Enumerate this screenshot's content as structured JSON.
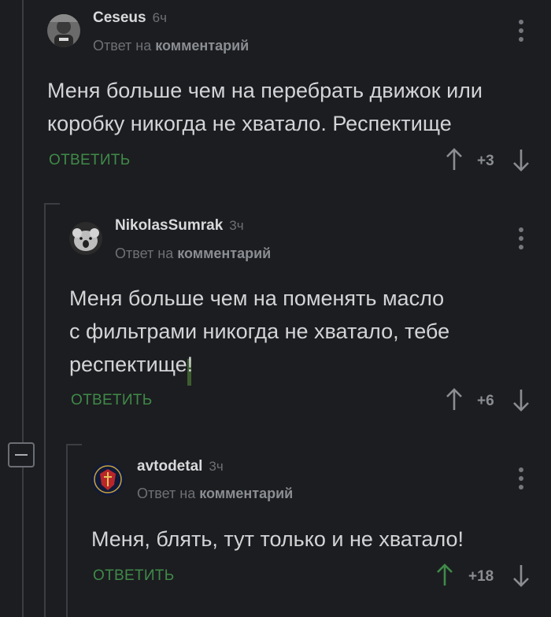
{
  "colors": {
    "background": "#1c1d20",
    "accent_green": "#3f8a49",
    "text": "#d3d4d6",
    "muted": "#6d7075"
  },
  "comments": [
    {
      "author": "Ceseus",
      "time": "6ч",
      "reply_prefix": "Ответ на",
      "reply_link": "комментарий",
      "text": "Меня больше чем на перебрать движок или\nкоробку никогда не хватало. Респектище",
      "reply_label": "ОТВЕТИТЬ",
      "score": "+3",
      "upvoted": false
    },
    {
      "author": "NikolasSumrak",
      "time": "3ч",
      "reply_prefix": "Ответ на",
      "reply_link": "комментарий",
      "text": "Меня больше чем на поменять масло\nс фильтрами никогда не хватало, тебе\nреспектище",
      "text_tail": "!",
      "reply_label": "ОТВЕТИТЬ",
      "score": "+6",
      "upvoted": false
    },
    {
      "author": "avtodetal",
      "time": "3ч",
      "reply_prefix": "Ответ на",
      "reply_link": "комментарий",
      "text": "Меня, блять, тут только и не хватало!",
      "reply_label": "ОТВЕТИТЬ",
      "score": "+18",
      "upvoted": true
    }
  ],
  "icons": {
    "upvote": "arrow-up-icon",
    "downvote": "arrow-down-icon",
    "more": "kebab-menu-icon",
    "collapse": "minus-icon"
  }
}
